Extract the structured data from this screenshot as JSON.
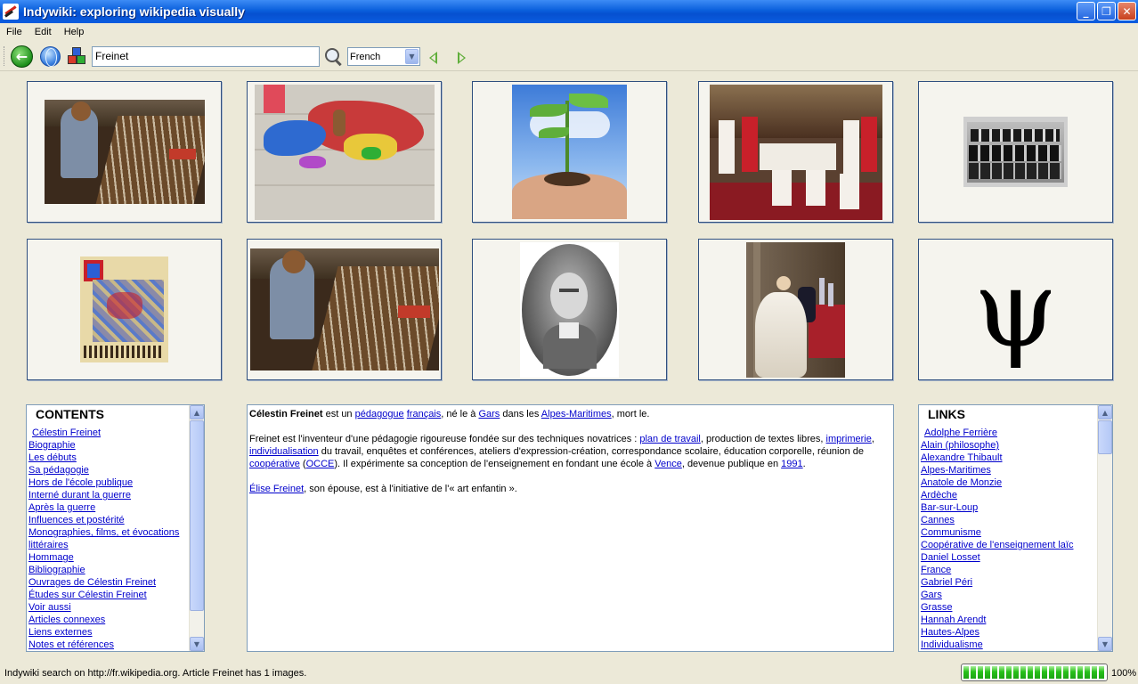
{
  "window": {
    "title": "Indywiki: exploring wikipedia visually"
  },
  "menu": [
    "File",
    "Edit",
    "Help"
  ],
  "toolbar": {
    "search_value": "Freinet",
    "language": "French"
  },
  "images": [
    {
      "alt": "child at printing type case"
    },
    {
      "alt": "large floor map with children"
    },
    {
      "alt": "seedling in hands"
    },
    {
      "alt": "religious ceremony"
    },
    {
      "alt": "group photograph"
    },
    {
      "alt": "illuminated manuscript"
    },
    {
      "alt": "child at printing type case"
    },
    {
      "alt": "engraved portrait"
    },
    {
      "alt": "painting of couple in laboratory"
    },
    {
      "alt": "psi symbol",
      "glyph": "ψ"
    }
  ],
  "contents": {
    "title": "CONTENTS",
    "items": [
      "Célestin Freinet",
      "Biographie",
      "Les débuts",
      "Sa pédagogie",
      "Hors de l'école publique",
      "Interné durant la guerre",
      "Après la guerre",
      "Influences et postérité",
      "Monographies, films, et évocations ",
      "littéraires",
      "Hommage",
      "Bibliographie",
      "Ouvrages de Célestin Freinet",
      "Études sur Célestin Freinet",
      "Voir aussi",
      "Articles connexes",
      "Liens externes",
      "Notes et références"
    ]
  },
  "links": {
    "title": "LINKS",
    "items": [
      "Adolphe Ferrière",
      "Alain (philosophe)",
      "Alexandre Thibault",
      "Alpes-Maritimes",
      "Anatole de Monzie",
      "Ardèche",
      "Bar-sur-Loup",
      "Cannes",
      "Communisme",
      "Coopérative de l'enseignement laïc",
      "Daniel Losset",
      "France",
      "Gabriel Péri",
      "Gars",
      "Grasse",
      "Hannah Arendt",
      "Hautes-Alpes",
      "Individualisme"
    ]
  },
  "article": {
    "p1": {
      "name": "Célestin Freinet",
      "t1": " est un ",
      "l1": "pédagogue",
      "t2": " ",
      "l2": "français",
      "t3": ", né le à ",
      "l3": "Gars",
      "t4": " dans les ",
      "l4": "Alpes-Maritimes",
      "t5": ", mort le."
    },
    "p2": {
      "t1": "Freinet est l'inventeur d'une pédagogie rigoureuse fondée sur des techniques novatrices : ",
      "l1": "plan de travail",
      "t2": ", production de textes libres, ",
      "l2": "imprimerie",
      "t3": ", ",
      "l3": "individualisation",
      "t4": " du travail, enquêtes et conférences, ateliers d'expression-création, correspondance scolaire, éducation corporelle, réunion de ",
      "l4": "coopérative",
      "t5": " (",
      "l5": "OCCE",
      "t6": "). Il expérimente sa conception de l'enseignement en fondant une école à ",
      "l6": "Vence",
      "t7": ", devenue publique en ",
      "l7": "1991",
      "t8": "."
    },
    "p3": {
      "l1": "Élise Freinet",
      "t1": ", son épouse, est à l'initiative de l'« art enfantin »."
    }
  },
  "status": {
    "text": "Indywiki search on http://fr.wikipedia.org. Article Freinet has 1 images.",
    "progress_value": 100,
    "progress_label": "100%"
  },
  "colors": {
    "link": "#0000cc",
    "titlebar": "#0a5fdc",
    "progress": "#27c01a",
    "background": "#ece9d8"
  }
}
